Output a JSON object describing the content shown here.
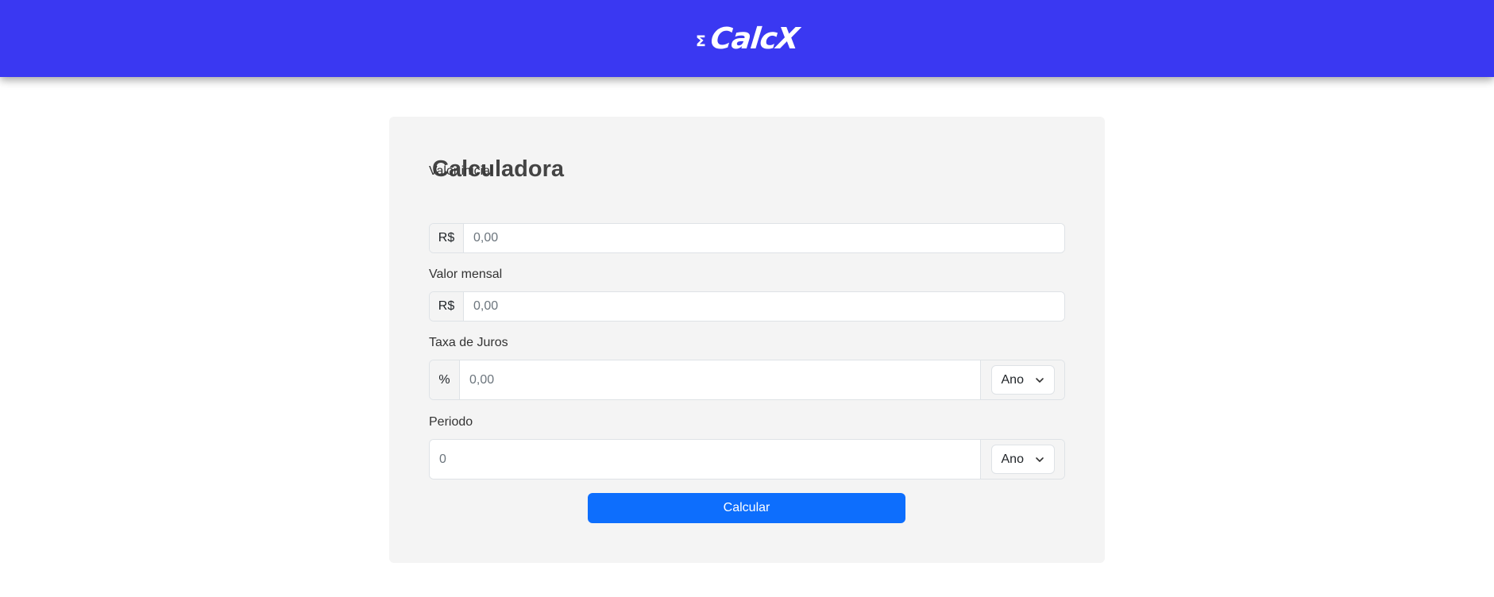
{
  "header": {
    "logo_symbol": "Σ",
    "logo_text": "CalcX",
    "background_color": "#3a38f2"
  },
  "form": {
    "title": "Calculadora",
    "initial_value": {
      "label": "Valor inicial",
      "prefix": "R$",
      "placeholder": "0,00"
    },
    "monthly_value": {
      "label": "Valor mensal",
      "prefix": "R$",
      "placeholder": "0,00"
    },
    "interest_rate": {
      "label": "Taxa de Juros",
      "prefix": "%",
      "placeholder": "0,00",
      "unit_selected": "Ano"
    },
    "period": {
      "label": "Periodo",
      "placeholder": "0",
      "unit_selected": "Ano"
    },
    "submit_label": "Calcular",
    "button_color": "#0d6efd"
  }
}
